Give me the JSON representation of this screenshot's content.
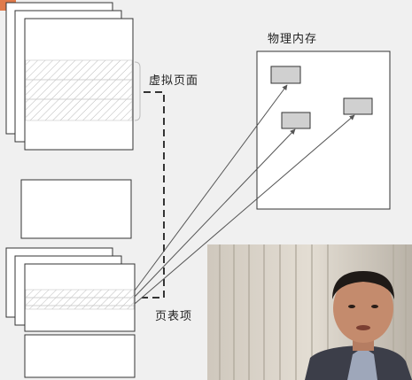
{
  "diagram": {
    "labels": {
      "virtual_page": "虚拟页面",
      "physical_memory": "物理内存",
      "page_table_entry": "页表项"
    }
  },
  "colors": {
    "background": "#f0f0f0",
    "page_stroke": "#333333",
    "frame_fill": "#d0d0d0",
    "arrow": "#555555",
    "hatch": "#bdbdbd",
    "corner_accent": "#e07a4a"
  }
}
